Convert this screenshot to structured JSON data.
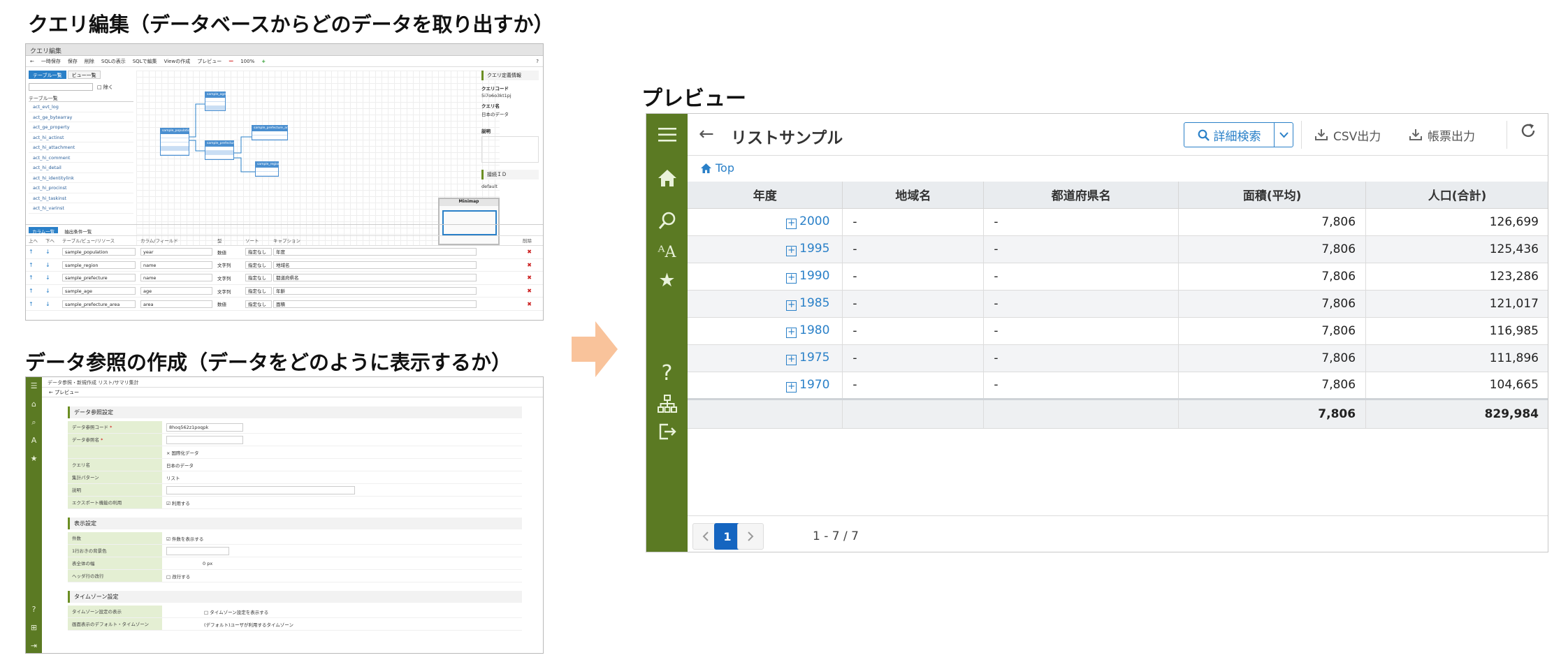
{
  "headings": {
    "query_edit": "クエリ編集（データベースからどのデータを取り出すか）",
    "data_ref": "データ参照の作成（データをどのように表示するか）",
    "preview": "プレビュー"
  },
  "query_editor": {
    "title": "クエリ編集",
    "toolbar": [
      "←",
      "一時保存",
      "保存",
      "削除",
      "SQLの表示",
      "SQLで編集",
      "Viewの作成",
      "プレビュー",
      "ー",
      "100%",
      "+"
    ],
    "tabs": [
      "テーブル一覧",
      "ビュー一覧"
    ],
    "search_checkbox_label": "□ 除く",
    "list_header": "テーブル一覧",
    "tables": [
      "act_evt_log",
      "act_ge_bytearray",
      "act_ge_property",
      "act_hi_actinst",
      "act_hi_attachment",
      "act_hi_comment",
      "act_hi_detail",
      "act_hi_identitylink",
      "act_hi_procinst",
      "act_hi_taskinst",
      "act_hi_varinst"
    ],
    "diagram_tables": [
      "sample_population",
      "sample_age",
      "sample_prefecture",
      "sample_prefecture_area",
      "sample_region"
    ],
    "minimap_label": "Minimap",
    "right_panel": {
      "section1": "クエリ定義情報",
      "code_label": "クエリコード",
      "code_value": "5i7o6o3kt1pj",
      "name_label": "クエリ名",
      "name_value": "日本のデータ",
      "desc_label": "説明",
      "section2": "接続ＩＤ",
      "conn_value": "default"
    },
    "bottom_tabs": [
      "カラム一覧",
      "抽出条件一覧"
    ],
    "col_headers": [
      "上へ",
      "下へ",
      "テーブル/ビュー/リソース",
      "カラム/フィールド",
      "型",
      "ソート",
      "キャプション",
      "削除"
    ],
    "rows": [
      {
        "table": "sample_population",
        "column": "year",
        "type": "数値",
        "sort": "指定なし",
        "caption": "年度"
      },
      {
        "table": "sample_region",
        "column": "name",
        "type": "文字列",
        "sort": "指定なし",
        "caption": "地域名"
      },
      {
        "table": "sample_prefecture",
        "column": "name",
        "type": "文字列",
        "sort": "指定なし",
        "caption": "都道府県名"
      },
      {
        "table": "sample_age",
        "column": "age",
        "type": "文字列",
        "sort": "指定なし",
        "caption": "年齢"
      },
      {
        "table": "sample_prefecture_area",
        "column": "area",
        "type": "数値",
        "sort": "指定なし",
        "caption": "面積"
      }
    ]
  },
  "data_reference": {
    "breadcrumb": "データ参照・新規作成 リスト/サマリ集計",
    "tab": "プレビュー",
    "section1": "データ参照設定",
    "fields1": [
      {
        "label": "データ参照コード",
        "value": "8hoq562z1poqpk",
        "req": "*"
      },
      {
        "label": "データ参照名",
        "value": "",
        "req": "*"
      },
      {
        "label": "",
        "value": "× 国際化データ",
        "req": ""
      },
      {
        "label": "クエリ名",
        "value": "日本のデータ",
        "req": ""
      },
      {
        "label": "集計パターン",
        "value": "リスト",
        "req": ""
      },
      {
        "label": "説明",
        "value": "",
        "req": ""
      },
      {
        "label": "エクスポート機能の利用",
        "value": "☑ 利用する",
        "req": ""
      }
    ],
    "section2": "表示設定",
    "fields2": [
      {
        "label": "件数",
        "value": "☑ 件数を表示する"
      },
      {
        "label": "1行おきの背景色",
        "value": ""
      },
      {
        "label": "表全体の幅",
        "value": "0 px"
      },
      {
        "label": "ヘッダ行の改行",
        "value": "□ 改行する"
      }
    ],
    "section3": "タイムゾーン設定",
    "fields3": [
      {
        "label": "タイムゾーン設定の表示",
        "value": "□ タイムゾーン設定を表示する"
      },
      {
        "label": "画面表示のデフォルト・タイムゾーン",
        "value": "(デフォルト)ユーザが利用するタイムゾーン"
      }
    ]
  },
  "preview": {
    "title": "リストサンプル",
    "advanced_search": "詳細検索",
    "csv_button": "CSV出力",
    "report_button": "帳票出力",
    "breadcrumb": "Top",
    "columns": [
      "年度",
      "地域名",
      "都道府県名",
      "面積(平均)",
      "人口(合計)"
    ],
    "rows": [
      {
        "year": "2000",
        "region": "-",
        "pref": "-",
        "area": "7,806",
        "pop": "126,699"
      },
      {
        "year": "1995",
        "region": "-",
        "pref": "-",
        "area": "7,806",
        "pop": "125,436"
      },
      {
        "year": "1990",
        "region": "-",
        "pref": "-",
        "area": "7,806",
        "pop": "123,286"
      },
      {
        "year": "1985",
        "region": "-",
        "pref": "-",
        "area": "7,806",
        "pop": "121,017"
      },
      {
        "year": "1980",
        "region": "-",
        "pref": "-",
        "area": "7,806",
        "pop": "116,985"
      },
      {
        "year": "1975",
        "region": "-",
        "pref": "-",
        "area": "7,806",
        "pop": "111,896"
      },
      {
        "year": "1970",
        "region": "-",
        "pref": "-",
        "area": "7,806",
        "pop": "104,665"
      }
    ],
    "total": {
      "area": "7,806",
      "pop": "829,984"
    },
    "pager": {
      "current": "1",
      "info": "1 - 7 / 7"
    }
  },
  "colors": {
    "sidebar": "#5b7a23",
    "accent": "#2a80c8",
    "arrow": "#f9c39b",
    "pager_active": "#1565c0"
  }
}
